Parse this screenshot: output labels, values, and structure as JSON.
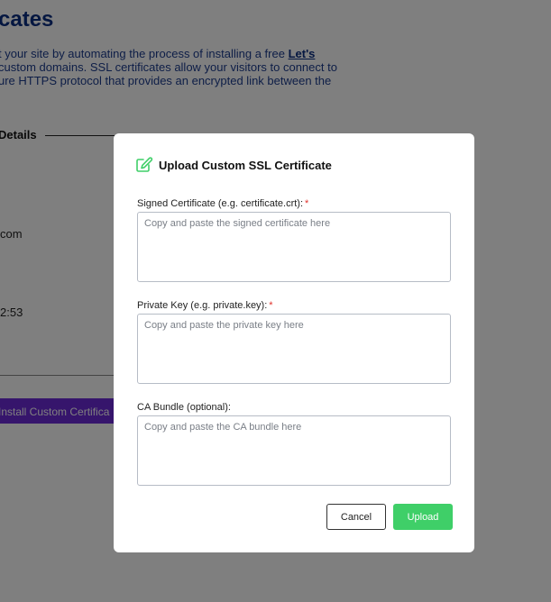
{
  "background": {
    "title": "cates",
    "paragraph_lines": [
      "t your site by automating the process of installing a free ",
      "custom domains. SSL certificates allow your visitors to connect to",
      "ure HTTPS protocol that provides an encrypted link between the"
    ],
    "paragraph_link": "Let's",
    "section_heading": "Details",
    "text_1": "com",
    "text_2": "2:53",
    "install_button_label": "Install Custom Certifica"
  },
  "modal": {
    "title": "Upload Custom SSL Certificate",
    "icon": "edit-icon",
    "fields": [
      {
        "label": "Signed Certificate (e.g. certificate.crt):",
        "required": true,
        "required_mark": "*",
        "placeholder": "Copy and paste the signed certificate here",
        "value": ""
      },
      {
        "label": "Private Key (e.g. private.key):",
        "required": true,
        "required_mark": "*",
        "placeholder": "Copy and paste the private key here",
        "value": ""
      },
      {
        "label": "CA Bundle (optional):",
        "required": false,
        "placeholder": "Copy and paste the CA bundle here",
        "value": ""
      }
    ],
    "cancel_label": "Cancel",
    "upload_label": "Upload"
  },
  "colors": {
    "accent_green": "#3fcf68",
    "heading_blue": "#0b2e82",
    "required_red": "#e0312b",
    "install_purple": "#6d2ad9"
  }
}
